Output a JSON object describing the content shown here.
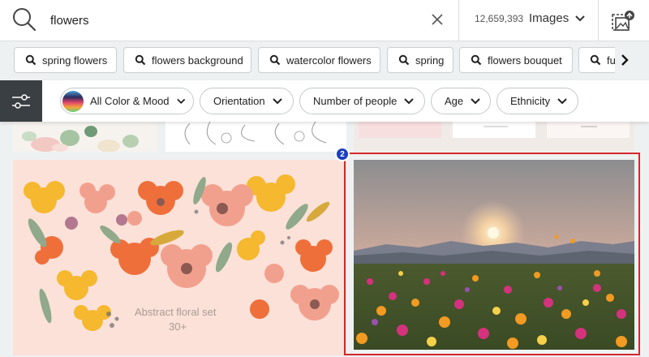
{
  "search": {
    "query": "flowers",
    "result_count": "12,659,393",
    "asset_type": "Images"
  },
  "icons": {
    "search": "search-icon",
    "clear": "close-icon",
    "dropdown": "chevron-down-icon",
    "visual_search": "image-upload-icon",
    "filters": "sliders-icon",
    "next": "chevron-right-icon"
  },
  "suggestions": [
    "spring flowers",
    "flowers background",
    "watercolor flowers",
    "spring",
    "flowers bouquet",
    "fu"
  ],
  "filters": {
    "color": "All Color & Mood",
    "orientation": "Orientation",
    "people": "Number of people",
    "age": "Age",
    "ethnicity": "Ethnicity"
  },
  "results": {
    "abstract_caption_line1": "Abstract floral set",
    "abstract_caption_line2": "30+",
    "badge": "2"
  },
  "colors": {
    "highlight": "#d6262c",
    "badge": "#1b3fbf",
    "filter_toggle": "#3a3f44"
  }
}
